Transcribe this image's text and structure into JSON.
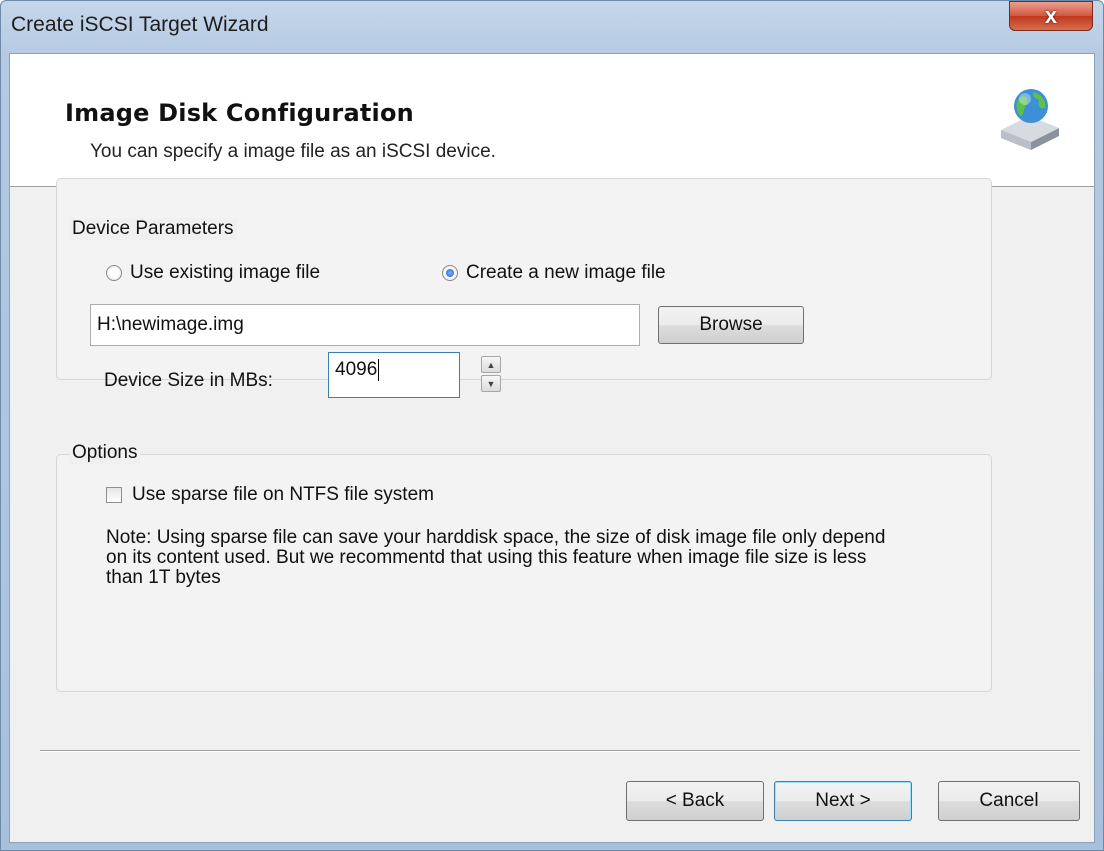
{
  "window": {
    "title": "Create iSCSI Target Wizard",
    "close_symbol": "x"
  },
  "header": {
    "title": "Image Disk Configuration",
    "subtitle": "You can specify a image file as an iSCSI device.",
    "icon": "network-disk-icon"
  },
  "device_parameters": {
    "label": "Device Parameters",
    "radio_existing": {
      "label": "Use existing image file",
      "selected": false
    },
    "radio_new": {
      "label": "Create a new image file",
      "selected": true
    },
    "file_path": "H:\\newimage.img",
    "browse_label": "Browse",
    "size_label": "Device Size in MBs:",
    "size_value": "4096"
  },
  "options": {
    "label": "Options",
    "sparse_label": "Use sparse file on NTFS file system",
    "sparse_checked": false,
    "note": "Note: Using sparse file can save your harddisk space, the size of disk image file only depend on its content used. But we recommentd that using this feature when image file size is less than 1T bytes"
  },
  "footer": {
    "back_label": "< Back",
    "next_label": "Next >",
    "cancel_label": "Cancel"
  }
}
